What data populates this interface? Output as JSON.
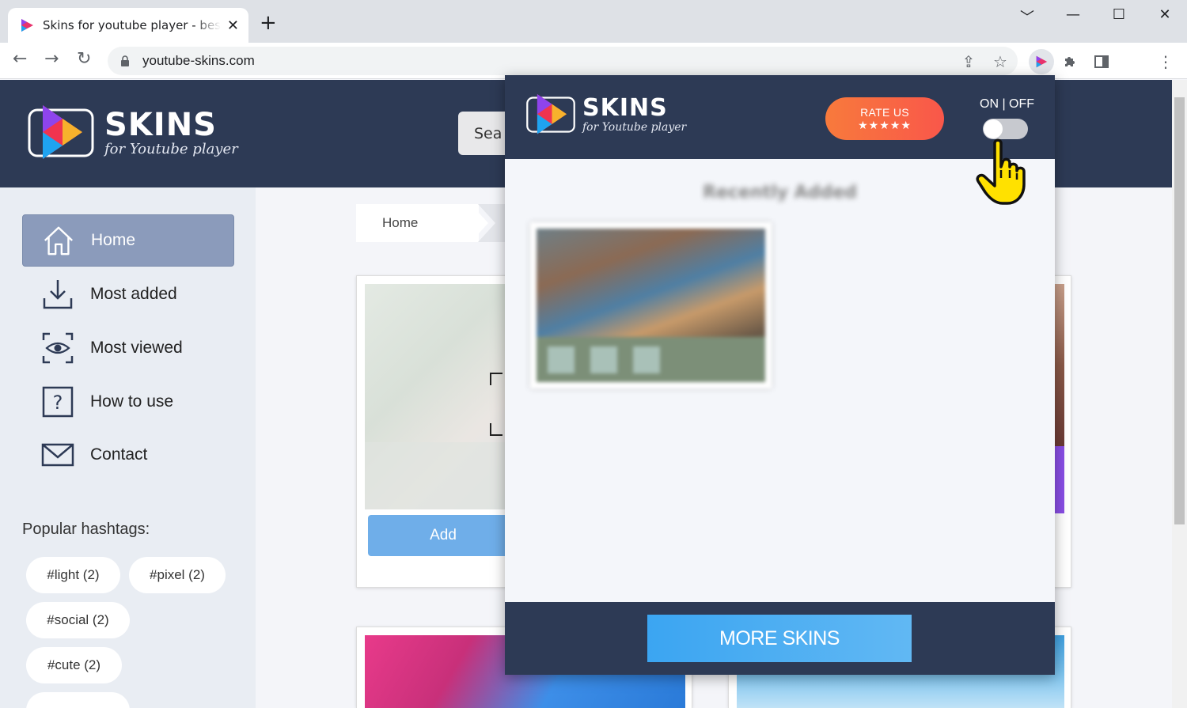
{
  "browser": {
    "tab_title": "Skins for youtube player - best re",
    "url": "youtube-skins.com"
  },
  "site": {
    "logo_word": "SKINS",
    "logo_sub": "for Youtube player",
    "search_label": "Sea",
    "nav": [
      {
        "label": "Home",
        "icon": "home-icon",
        "active": true
      },
      {
        "label": "Most added",
        "icon": "download-icon",
        "active": false
      },
      {
        "label": "Most viewed",
        "icon": "eye-icon",
        "active": false
      },
      {
        "label": "How to use",
        "icon": "question-icon",
        "active": false
      },
      {
        "label": "Contact",
        "icon": "mail-icon",
        "active": false
      }
    ],
    "popular_title": "Popular hashtags:",
    "tags": [
      "#light (2)",
      "#pixel (2)",
      "#social (2)",
      "#cute (2)"
    ],
    "breadcrumb": "Home",
    "add_button": "Add"
  },
  "popup": {
    "logo_word": "SKINS",
    "logo_sub": "for Youtube player",
    "rate_label": "RATE US",
    "rate_stars": "★★★★★",
    "onoff_label": "ON | OFF",
    "toggle_on": false,
    "section_title": "Recently Added",
    "more_button": "MORE SKINS"
  },
  "colors": {
    "header": "#2d3a55",
    "accent_blue": "#3ba5f2",
    "rate_orange": "#f87a3c",
    "nav_active": "#8b9bbb"
  }
}
